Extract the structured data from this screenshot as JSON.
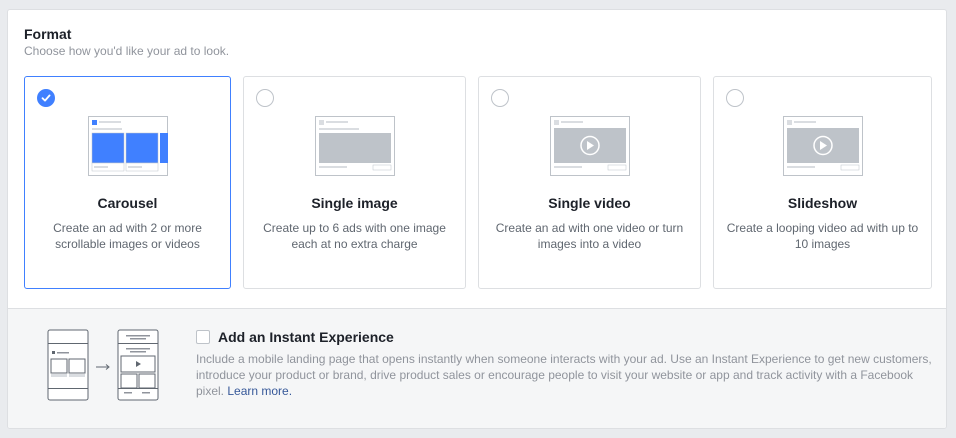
{
  "format": {
    "title": "Format",
    "subtitle": "Choose how you'd like your ad to look."
  },
  "options": [
    {
      "name": "Carousel",
      "description": "Create an ad with 2 or more scrollable images or videos",
      "selected": true
    },
    {
      "name": "Single image",
      "description": "Create up to 6 ads with one image each at no extra charge",
      "selected": false
    },
    {
      "name": "Single video",
      "description": "Create an ad with one video or turn images into a video",
      "selected": false
    },
    {
      "name": "Slideshow",
      "description": "Create a looping video ad with up to 10 images",
      "selected": false
    }
  ],
  "instant_experience": {
    "title": "Add an Instant Experience",
    "checked": false,
    "description": "Include a mobile landing page that opens instantly when someone interacts with your ad. Use an Instant Experience to get new customers, introduce your product or brand, drive product sales or encourage people to visit your website or app and track activity with a Facebook pixel.",
    "link_text": "Learn more."
  },
  "colors": {
    "accent": "#4080ff",
    "border": "#dddfe2",
    "link": "#365899"
  },
  "icons": {
    "selected": "checkmark-icon",
    "carousel": "carousel-thumbnail-icon",
    "single_image": "image-thumbnail-icon",
    "single_video": "video-play-icon",
    "slideshow": "slideshow-play-icon"
  }
}
